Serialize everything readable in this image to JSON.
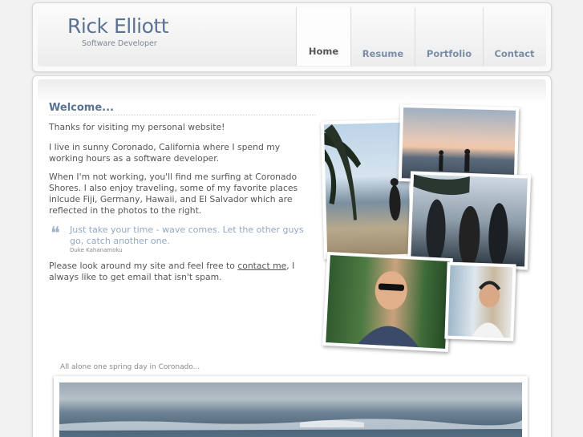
{
  "header": {
    "title": "Rick Elliott",
    "subtitle": "Software Developer"
  },
  "nav": {
    "items": [
      {
        "label": "Home",
        "active": true
      },
      {
        "label": "Resume",
        "active": false
      },
      {
        "label": "Portfolio",
        "active": false
      },
      {
        "label": "Contact",
        "active": false
      }
    ]
  },
  "main": {
    "heading": "Welcome...",
    "paragraph1": "Thanks for visiting my personal website!",
    "paragraph2": "I live in sunny Coronado, California where I spend my working hours as a software developer.",
    "paragraph3": "When I'm not working, you'll find me surfing at Coronado Shores. I also enjoy traveling, some of my favorite places inlcude Fiji, Germany, Hawaii, and El Salvador which are reflected in the photos to the right.",
    "quote": {
      "text": "Just take your time - wave comes. Let the other guys go, catch another one.",
      "author": "Duke Kahanamoku"
    },
    "paragraph4_before": "Please look around my site and feel free to ",
    "paragraph4_link": "contact me",
    "paragraph4_after": ", I always like to get email that isn't spam."
  },
  "gallery": {
    "caption": "All alone one spring day in Coronado..."
  },
  "colors": {
    "accent": "#5a7393",
    "quote": "#92a9c1",
    "background": "#f2f2f2"
  }
}
